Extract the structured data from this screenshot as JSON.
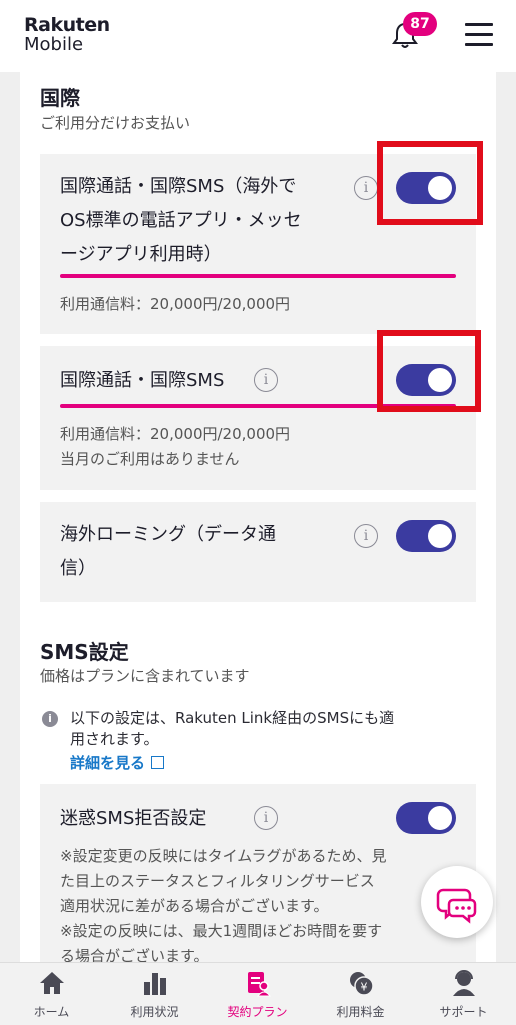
{
  "header": {
    "logo_line1": "Rakuten",
    "logo_line2": "Mobile",
    "notification_count": "87"
  },
  "international": {
    "title": "国際",
    "subtitle": "ご利用分だけお支払い",
    "cards": [
      {
        "title_lines": [
          "国際通話・国際SMS（海外で",
          "OS標準の電話アプリ・メッセ",
          "ージアプリ利用時）"
        ],
        "toggle_on": true,
        "usage_text": "利用通信料：20,000円/20,000円",
        "usage_fraction": 1.0
      },
      {
        "title_lines": [
          "国際通話・国際SMS"
        ],
        "toggle_on": true,
        "usage_text": "利用通信料：20,000円/20,000円",
        "note": "当月のご利用はありません",
        "usage_fraction": 1.0
      },
      {
        "title_lines": [
          "海外ローミング（データ通",
          "信）"
        ],
        "toggle_on": true
      }
    ]
  },
  "sms": {
    "title": "SMS設定",
    "subtitle": "価格はプランに含まれています",
    "note_lines": [
      "以下の設定は、Rakuten Link経由のSMSにも適",
      "用されます。"
    ],
    "detail_link": "詳細を見る",
    "spam_card": {
      "title": "迷惑SMS拒否設定",
      "toggle_on": true,
      "desc_lines": [
        "※設定変更の反映にはタイムラグがあるため、見",
        "た目上のステータスとフィルタリングサービス",
        "適用状況に差がある場合がございます。",
        "※設定の反映には、最大1週間ほどお時間を要す",
        "る場合がございます。"
      ]
    }
  },
  "nav": {
    "items": [
      {
        "label": "ホーム",
        "icon": "home-icon",
        "active": false
      },
      {
        "label": "利用状況",
        "icon": "bar-chart-icon",
        "active": false
      },
      {
        "label": "契約プラン",
        "icon": "plan-icon",
        "active": true
      },
      {
        "label": "利用料金",
        "icon": "yen-coin-icon",
        "active": false
      },
      {
        "label": "サポート",
        "icon": "support-icon",
        "active": false
      }
    ]
  },
  "colors": {
    "accent": "#e3007e",
    "toggle": "#3b3ba0",
    "highlight_box": "#e10d1b",
    "link": "#1878c8"
  }
}
